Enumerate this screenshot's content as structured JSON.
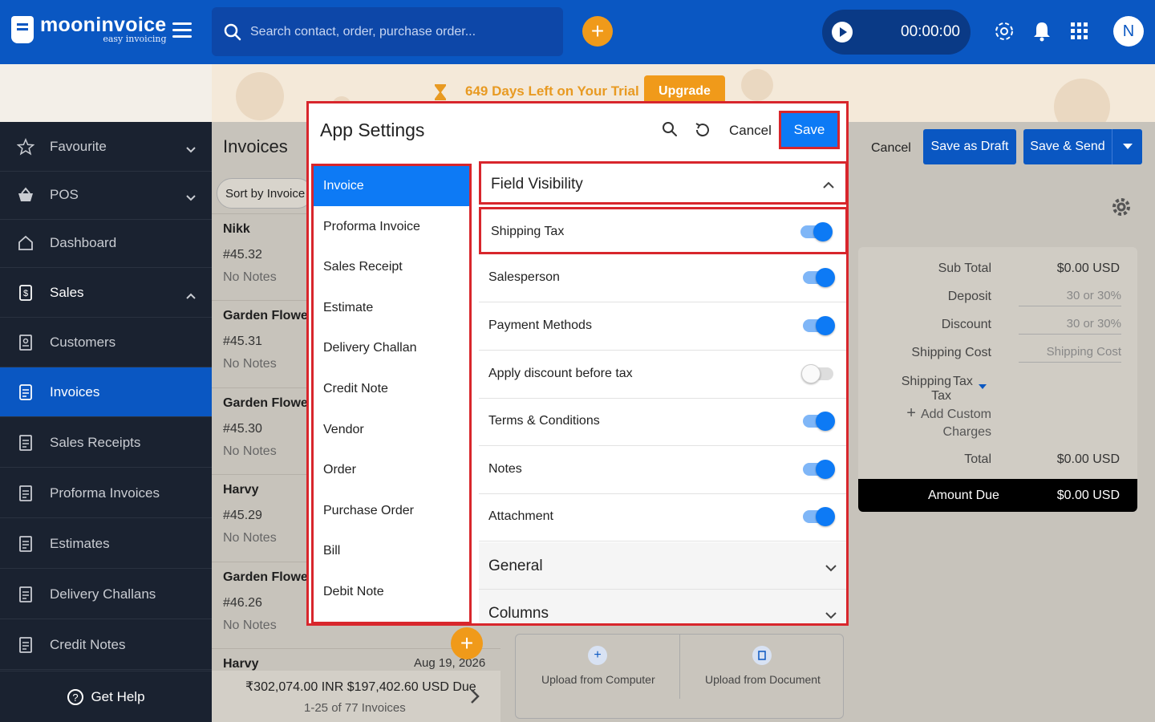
{
  "app": {
    "logo_name": "mooninvoice",
    "logo_tagline": "easy invoicing",
    "avatar_initial": "N",
    "timer": "00:00:00",
    "accent_color": "#0a57c2",
    "orange_color": "#f09a1a"
  },
  "search": {
    "placeholder": "Search contact, order, purchase order..."
  },
  "banner": {
    "trial_text": "649 Days Left on Your Trial",
    "upgrade_label": "Upgrade"
  },
  "sidebar": {
    "items": [
      {
        "label": "Favourite",
        "icon": "star-icon",
        "chevron": "down"
      },
      {
        "label": "POS",
        "icon": "basket-icon",
        "chevron": "down"
      },
      {
        "label": "Dashboard",
        "icon": "home-icon"
      },
      {
        "label": "Sales",
        "icon": "dollar-doc-icon",
        "chevron": "up"
      },
      {
        "label": "Customers",
        "icon": "contacts-icon"
      },
      {
        "label": "Invoices",
        "icon": "invoice-icon",
        "active": true
      },
      {
        "label": "Sales Receipts",
        "icon": "receipt-icon"
      },
      {
        "label": "Proforma Invoices",
        "icon": "proforma-icon"
      },
      {
        "label": "Estimates",
        "icon": "calculator-icon"
      },
      {
        "label": "Delivery Challans",
        "icon": "delivery-doc-icon"
      },
      {
        "label": "Credit Notes",
        "icon": "credit-note-icon"
      }
    ],
    "get_help": "Get Help"
  },
  "invoice_list": {
    "title": "Invoices",
    "sort_label": "Sort by",
    "sort_value": "Invoice",
    "rows": [
      {
        "name": "Nikk",
        "number": "#45.32",
        "notes": "No Notes"
      },
      {
        "name": "Garden Flower",
        "number": "#45.31",
        "notes": "No Notes"
      },
      {
        "name": "Garden Flower",
        "number": "#45.30",
        "notes": "No Notes"
      },
      {
        "name": "Harvy",
        "number": "#45.29",
        "notes": "No Notes"
      },
      {
        "name": "Garden Flower",
        "number": "#46.26",
        "notes": "No Notes"
      },
      {
        "name": "Harvy",
        "number": "",
        "notes": ""
      }
    ],
    "partial_date": "Aug 19, 2026",
    "totals": "₹302,074.00 INR  $197,402.60 USD  Due",
    "count_text": "1-25 of 77 Invoices"
  },
  "editor": {
    "cancel_label": "Cancel",
    "save_draft_label": "Save as Draft",
    "save_send_label": "Save & Send",
    "summary": {
      "sub_total_label": "Sub Total",
      "sub_total_value": "$0.00 USD",
      "deposit_label": "Deposit",
      "deposit_placeholder": "30 or 30%",
      "discount_label": "Discount",
      "discount_placeholder": "30 or 30%",
      "shipping_cost_label": "Shipping Cost",
      "shipping_cost_placeholder": "Shipping Cost",
      "shipping_tax_label": "Shipping Tax",
      "shipping_tax_value": "Tax",
      "add_custom_label": "Add Custom",
      "add_custom_label2": "Charges",
      "total_label": "Total",
      "total_value": "$0.00 USD",
      "amount_due_label": "Amount Due",
      "amount_due_value": "$0.00 USD"
    },
    "upload_computer": "Upload from Computer",
    "upload_document": "Upload from Document"
  },
  "modal": {
    "title": "App Settings",
    "cancel_label": "Cancel",
    "save_label": "Save",
    "left_items": [
      "Invoice",
      "Proforma Invoice",
      "Sales Receipt",
      "Estimate",
      "Delivery Challan",
      "Credit Note",
      "Vendor",
      "Order",
      "Purchase Order",
      "Bill",
      "Debit Note"
    ],
    "active_left_index": 0,
    "field_visibility_title": "Field Visibility",
    "fields": [
      {
        "label": "Shipping Tax",
        "on": true
      },
      {
        "label": "Salesperson",
        "on": true
      },
      {
        "label": "Payment Methods",
        "on": true
      },
      {
        "label": "Apply discount before tax",
        "on": false
      },
      {
        "label": "Terms & Conditions",
        "on": true
      },
      {
        "label": "Notes",
        "on": true
      },
      {
        "label": "Attachment",
        "on": true
      }
    ],
    "sections": [
      "General",
      "Columns"
    ]
  }
}
